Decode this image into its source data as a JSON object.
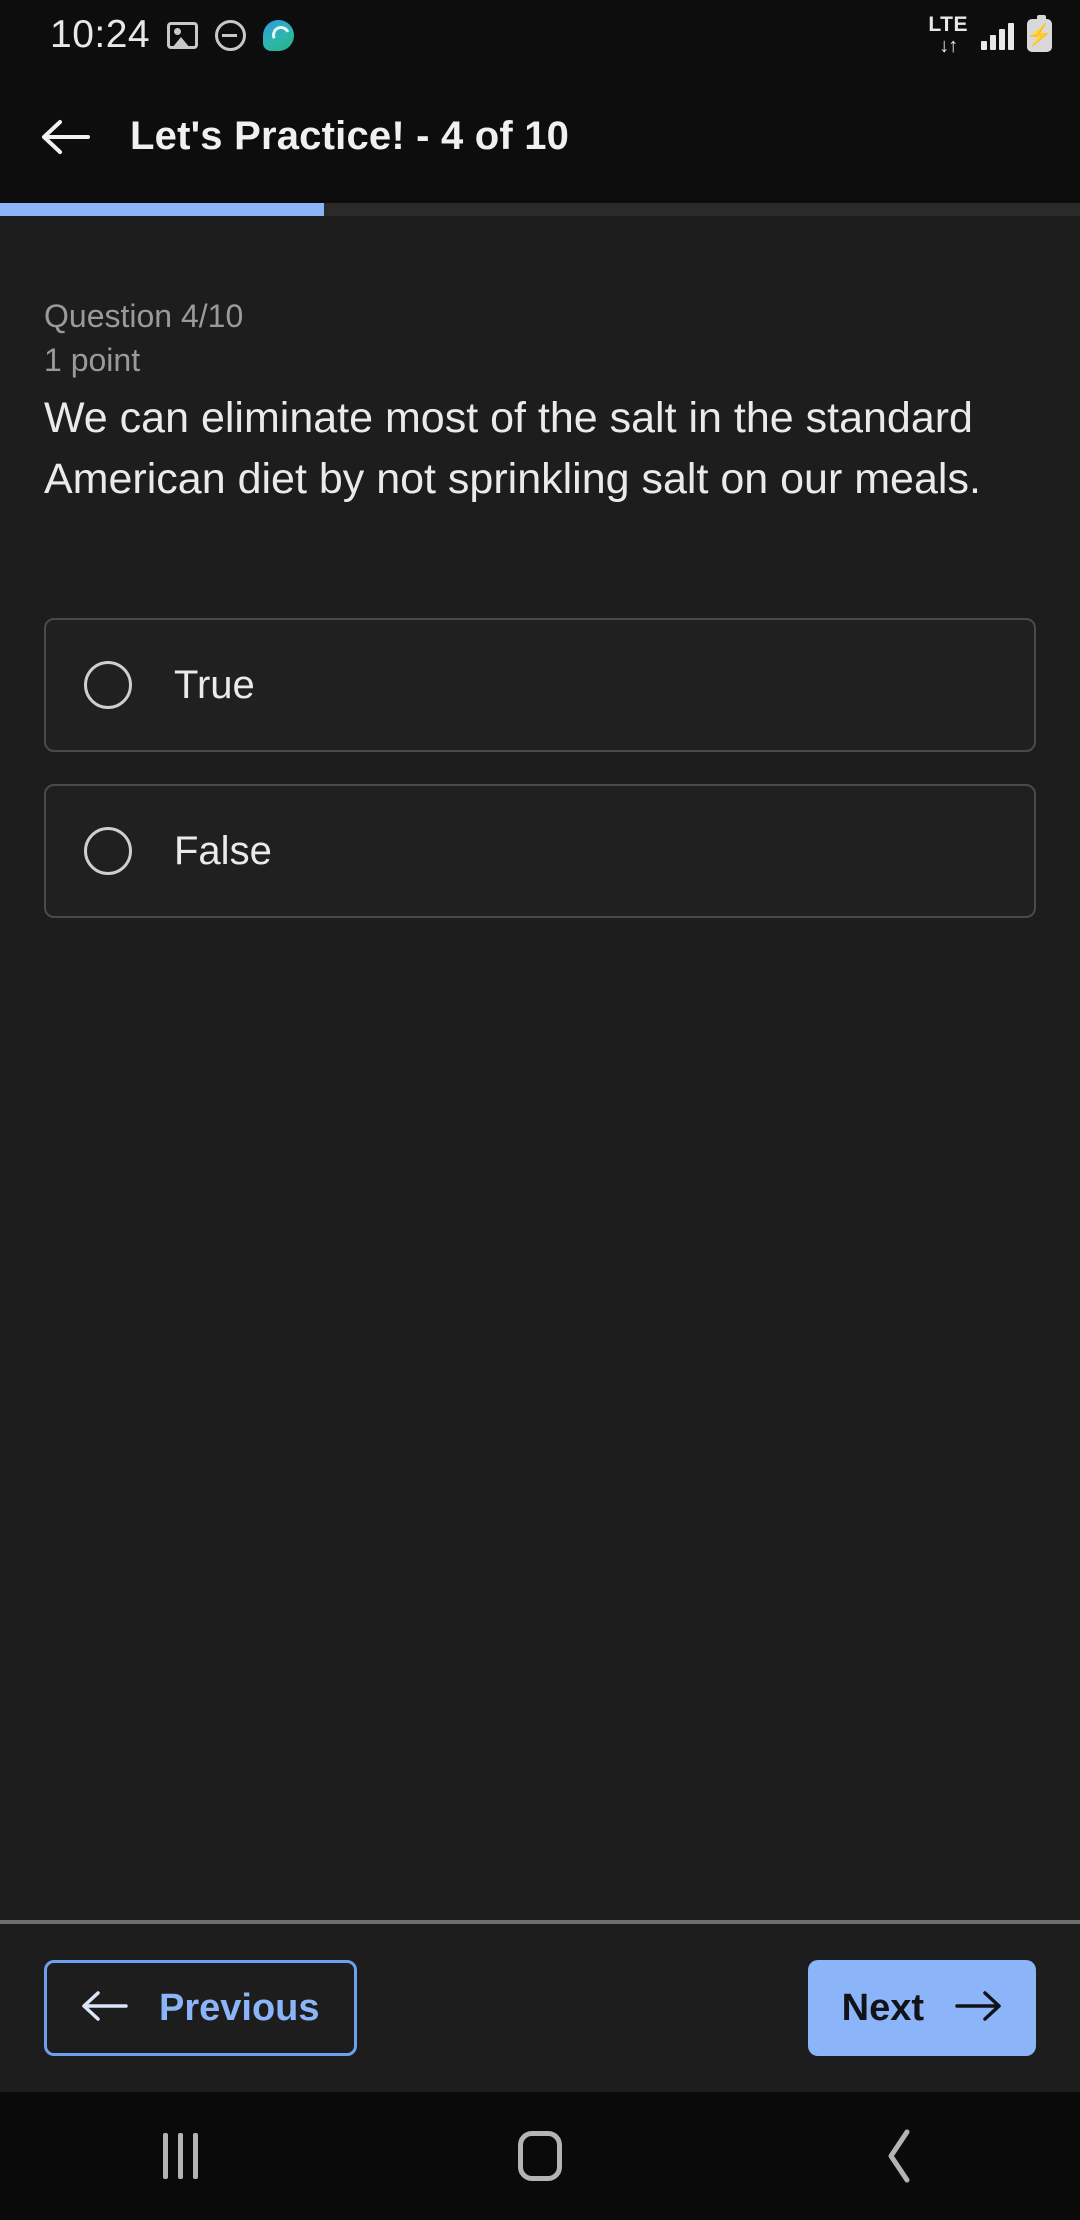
{
  "status_bar": {
    "clock": "10:24",
    "left_icons": [
      "screenshot-image-icon",
      "do-not-disturb-icon",
      "messages-app-icon"
    ],
    "network_label": "LTE",
    "network_arrows": "↓↑",
    "signal_icon": "signal-bars-icon",
    "battery_icon": "battery-charging-icon",
    "battery_glyph": "⚡"
  },
  "app_bar": {
    "back_icon": "back-arrow-icon",
    "title": "Let's Practice! - 4 of 10"
  },
  "progress": {
    "percent": 30,
    "fill_color": "#8cb4f8",
    "track_color": "#2a2a2a"
  },
  "question": {
    "counter": "Question 4/10",
    "points": "1 point",
    "text": "We can eliminate most of the salt in the standard American diet by not sprinkling salt on our meals.",
    "options": [
      {
        "label": "True",
        "selected": false
      },
      {
        "label": "False",
        "selected": false
      }
    ]
  },
  "footer": {
    "previous_label": "Previous",
    "previous_icon": "arrow-left-icon",
    "next_label": "Next",
    "next_icon": "arrow-right-icon",
    "accent_color": "#8cb4f8"
  },
  "nav_bar": {
    "recents_icon": "recents-icon",
    "home_icon": "home-icon",
    "back_icon": "back-chevron-icon",
    "back_glyph": "‹"
  }
}
